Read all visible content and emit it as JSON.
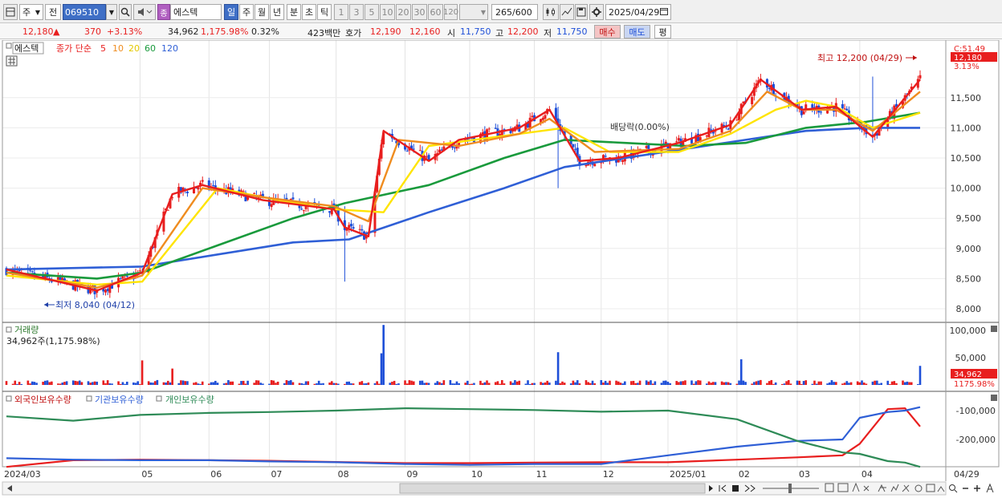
{
  "toolbar": {
    "stock_code": "069510",
    "stock_badge": "종",
    "stock_name": "에스텍",
    "labels": {
      "code_kind": "주",
      "prev": "전",
      "period_day": "일",
      "period_week": "주",
      "period_month": "월",
      "period_year": "년",
      "period_minute": "분",
      "period_second": "초",
      "period_tick": "틱"
    },
    "intervals": [
      "1",
      "3",
      "5",
      "10",
      "20",
      "30",
      "60",
      "120"
    ],
    "count_value": "265",
    "count_total": "/600",
    "date": "2025/04/29"
  },
  "quote": {
    "price": "12,180",
    "arrow": "▲",
    "change": "370",
    "change_pct": "+3.13%",
    "volume": "34,962",
    "volume_ratio": "1,175.98%",
    "turnover": "0.32%",
    "amount": "423백만",
    "ask_label": "호가",
    "ask": "12,190",
    "bid": "12,160",
    "open_label": "시",
    "open": "11,750",
    "high_label": "고",
    "high": "12,200",
    "low_label": "저",
    "low": "11,750",
    "buy_label": "매수",
    "sell_label": "매도",
    "eval_label": "평"
  },
  "colors": {
    "up": "#e81e1e",
    "down": "#1e4fd8",
    "ma5": "#e81e1e",
    "ma10": "#ef8c1f",
    "ma20": "#ffe400",
    "ma60": "#199a3c",
    "ma120": "#2f5fd6",
    "foreign": "#e81e1e",
    "institution": "#2f5fd6",
    "individual": "#2e8b57"
  },
  "chart_data": [
    {
      "type": "line",
      "panel": "price",
      "legend": {
        "stock": "에스텍",
        "title": "종가 단순",
        "periods": [
          "5",
          "10",
          "20",
          "60",
          "120"
        ]
      },
      "x_labels": [
        "2024/03",
        "05",
        "06",
        "07",
        "08",
        "09",
        "10",
        "11",
        "12",
        "2025/01",
        "02",
        "03",
        "04",
        "04/29"
      ],
      "ylim": [
        7850,
        12400
      ],
      "y_ticks": [
        "8,000",
        "8,500",
        "9,000",
        "9,500",
        "10,000",
        "10,500",
        "11,000",
        "11,500"
      ],
      "right_labels": {
        "c": "C:51.49",
        "close": "12,180",
        "pct": "3.13%"
      },
      "annotations": {
        "high": "최고 12,200 (04/29)",
        "low": "최저 8,040 (04/12)",
        "dividend": "배당락(0.00%)"
      },
      "series": [
        {
          "name": "5",
          "x": [
            "2024/03/01",
            "2024/04/12",
            "2024/05/03",
            "2024/05/17",
            "2024/05/31",
            "2024/06/28",
            "2024/07/31",
            "2024/08/05",
            "2024/08/16",
            "2024/08/23",
            "2024/09/13",
            "2024/09/27",
            "2024/10/25",
            "2024/11/08",
            "2024/11/22",
            "2024/12/10",
            "2025/01/07",
            "2025/01/31",
            "2025/02/14",
            "2025/03/05",
            "2025/03/21",
            "2025/04/07",
            "2025/04/29"
          ],
          "values": [
            8650,
            8300,
            8600,
            9900,
            10050,
            9800,
            9650,
            9350,
            9200,
            10950,
            10450,
            10800,
            11000,
            11300,
            10450,
            10500,
            10750,
            11050,
            11800,
            11300,
            11350,
            10850,
            11800
          ]
        },
        {
          "name": "10",
          "x": [
            "2024/03/01",
            "2024/04/12",
            "2024/05/03",
            "2024/05/31",
            "2024/06/28",
            "2024/07/31",
            "2024/08/16",
            "2024/08/30",
            "2024/09/27",
            "2024/10/25",
            "2024/11/08",
            "2024/11/29",
            "2025/01/07",
            "2025/01/31",
            "2025/02/17",
            "2025/03/05",
            "2025/03/21",
            "2025/04/07",
            "2025/04/29"
          ],
          "values": [
            8600,
            8350,
            8550,
            10000,
            9850,
            9700,
            9450,
            10800,
            10700,
            10900,
            11150,
            10600,
            10650,
            10950,
            11600,
            11300,
            11300,
            10950,
            11600
          ]
        },
        {
          "name": "20",
          "x": [
            "2024/03/01",
            "2024/04/12",
            "2024/05/03",
            "2024/06/07",
            "2024/07/05",
            "2024/07/31",
            "2024/08/23",
            "2024/09/13",
            "2024/10/25",
            "2024/11/15",
            "2024/12/06",
            "2025/01/07",
            "2025/01/31",
            "2025/02/21",
            "2025/03/07",
            "2025/03/21",
            "2025/04/07",
            "2025/04/29"
          ],
          "values": [
            8550,
            8400,
            8450,
            10000,
            9800,
            9650,
            9600,
            10700,
            10900,
            11000,
            10600,
            10600,
            10900,
            11300,
            11450,
            11350,
            11000,
            11250
          ]
        },
        {
          "name": "60",
          "x": [
            "2024/03/01",
            "2024/04/12",
            "2024/05/03",
            "2024/06/07",
            "2024/07/12",
            "2024/08/05",
            "2024/09/13",
            "2024/10/18",
            "2024/11/15",
            "2024/12/13",
            "2025/01/10",
            "2025/02/07",
            "2025/03/07",
            "2025/04/04",
            "2025/04/29"
          ],
          "values": [
            8600,
            8500,
            8600,
            9050,
            9500,
            9750,
            10050,
            10500,
            10800,
            10750,
            10700,
            10750,
            11000,
            11100,
            11250
          ]
        },
        {
          "name": "120",
          "x": [
            "2024/03/01",
            "2024/05/03",
            "2024/07/12",
            "2024/08/07",
            "2024/09/13",
            "2024/10/18",
            "2024/11/15",
            "2024/12/13",
            "2025/01/10",
            "2025/02/07",
            "2025/03/07",
            "2025/04/04",
            "2025/04/29"
          ],
          "values": [
            8650,
            8700,
            9100,
            9150,
            9600,
            10000,
            10350,
            10500,
            10650,
            10800,
            10950,
            11000,
            11000
          ]
        }
      ]
    },
    {
      "type": "bar",
      "panel": "volume",
      "title": "거래량",
      "readout": "34,962주(1,175.98%)",
      "ylim": [
        0,
        120000
      ],
      "y_ticks": [
        "100,000",
        "50,000"
      ],
      "right_labels": {
        "volume": "34,962",
        "ratio": "1175.98%"
      },
      "spikes": [
        {
          "x": "2024/05/03",
          "value": 45000
        },
        {
          "x": "2024/05/17",
          "value": 30000
        },
        {
          "x": "2024/08/22",
          "value": 58000
        },
        {
          "x": "2024/08/23",
          "value": 110000
        },
        {
          "x": "2024/11/12",
          "value": 60000
        },
        {
          "x": "2025/02/05",
          "value": 47000
        },
        {
          "x": "2025/04/29",
          "value": 34962
        }
      ]
    },
    {
      "type": "line",
      "panel": "holdings",
      "legend": [
        "외국인보유수량",
        "기관보유수량",
        "개인보유수량"
      ],
      "ylim": [
        -310000,
        -70000
      ],
      "y_ticks": [
        "-100,000",
        "-200,000"
      ],
      "x": [
        "2024/03/01",
        "2024/04/01",
        "2024/05/02",
        "2024/06/03",
        "2024/07/01",
        "2024/08/01",
        "2024/09/02",
        "2024/10/02",
        "2024/11/01",
        "2024/12/02",
        "2025/01/02",
        "2025/02/03",
        "2025/03/03",
        "2025/03/24",
        "2025/04/01",
        "2025/04/14",
        "2025/04/22",
        "2025/04/29"
      ],
      "series": [
        {
          "name": "외국인보유수량",
          "values": [
            -295000,
            -272000,
            -270000,
            -272000,
            -274000,
            -278000,
            -282000,
            -282000,
            -280000,
            -279000,
            -279000,
            -270000,
            -262000,
            -255000,
            -215000,
            -95000,
            -92000,
            -155000
          ]
        },
        {
          "name": "기관보유수량",
          "values": [
            -265000,
            -270000,
            -272000,
            -272000,
            -276000,
            -279000,
            -285000,
            -288000,
            -285000,
            -285000,
            -255000,
            -225000,
            -205000,
            -200000,
            -125000,
            -105000,
            -100000,
            -88000
          ]
        },
        {
          "name": "개인보유수량",
          "values": [
            -120000,
            -135000,
            -115000,
            -108000,
            -105000,
            -100000,
            -92000,
            -95000,
            -98000,
            -104000,
            -100000,
            -130000,
            -205000,
            -245000,
            -250000,
            -275000,
            -280000,
            -295000
          ]
        }
      ]
    }
  ]
}
